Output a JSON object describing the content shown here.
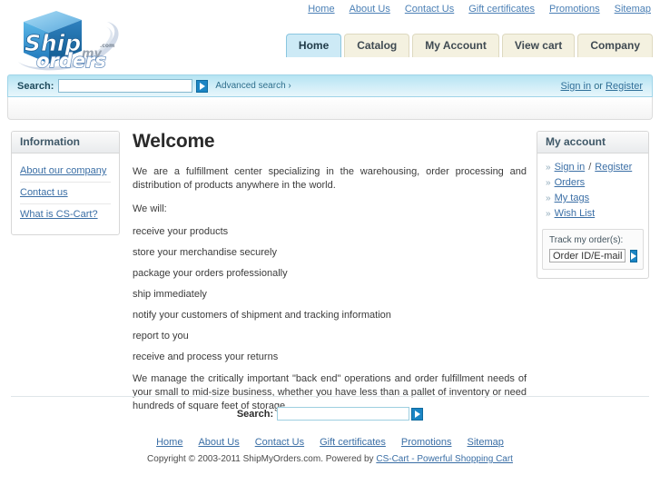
{
  "header": {
    "logo": {
      "alt": "ShipMyOrders logo",
      "word_ship": "Ship",
      "word_my": "my",
      "word_orders": "orders",
      "word_com": ".com"
    },
    "top_links": [
      {
        "label": "Home"
      },
      {
        "label": "About Us"
      },
      {
        "label": "Contact Us"
      },
      {
        "label": "Gift certificates"
      },
      {
        "label": "Promotions"
      },
      {
        "label": "Sitemap"
      }
    ],
    "tabs": [
      {
        "label": "Home",
        "active": true
      },
      {
        "label": "Catalog",
        "active": false
      },
      {
        "label": "My Account",
        "active": false
      },
      {
        "label": "View cart",
        "active": false
      },
      {
        "label": "Company",
        "active": false
      }
    ]
  },
  "search": {
    "label": "Search:",
    "value": "",
    "placeholder": "",
    "go_icon": "arrow-right-icon",
    "advanced_label": "Advanced search ›"
  },
  "account_bar": {
    "sign_in": "Sign in",
    "or": "or",
    "register": "Register"
  },
  "sidebar_left": {
    "title": "Information",
    "links": [
      {
        "label": "About our company"
      },
      {
        "label": "Contact us"
      },
      {
        "label": "What is CS-Cart?"
      }
    ]
  },
  "sidebar_right": {
    "title": "My account",
    "bullet": "»",
    "links": [
      {
        "label": "Sign in",
        "separator": "/",
        "label2": "Register"
      },
      {
        "label": "Orders"
      },
      {
        "label": "My tags"
      },
      {
        "label": "Wish List"
      }
    ],
    "track": {
      "label": "Track my order(s):",
      "value": "Order ID/E-mail",
      "go_icon": "arrow-right-icon"
    }
  },
  "main": {
    "title": "Welcome",
    "intro": "We are a fulfillment center specializing in the warehousing, order processing and distribution of products anywhere in the world.",
    "we_will": "We will:",
    "items": [
      "receive your products",
      "store your merchandise securely",
      "package your orders professionally",
      "ship immediately",
      "notify your customers of shipment and tracking information",
      "report to you",
      "receive and process your returns"
    ],
    "closing": "We manage the critically important \"back end\" operations and order fulfillment needs of your small to mid-size business, whether you have less than a pallet of inventory or need hundreds of square feet of storage."
  },
  "footer": {
    "search_label": "Search:",
    "search_value": "",
    "go_icon": "arrow-right-icon",
    "links": [
      {
        "label": "Home"
      },
      {
        "label": "About Us"
      },
      {
        "label": "Contact Us"
      },
      {
        "label": "Gift certificates"
      },
      {
        "label": "Promotions"
      },
      {
        "label": "Sitemap"
      }
    ],
    "copyright_text": "Copyright © 2003-2011 ShipMyOrders.com.  Powered by ",
    "copyright_link": "CS-Cart - Powerful Shopping Cart"
  },
  "colors": {
    "accent_blue": "#1b85c4",
    "tab_active": "#cdeaf6",
    "tab_inactive": "#f4f1e0",
    "link": "#3a6ea5",
    "searchbar_top": "#b5e4f2"
  }
}
